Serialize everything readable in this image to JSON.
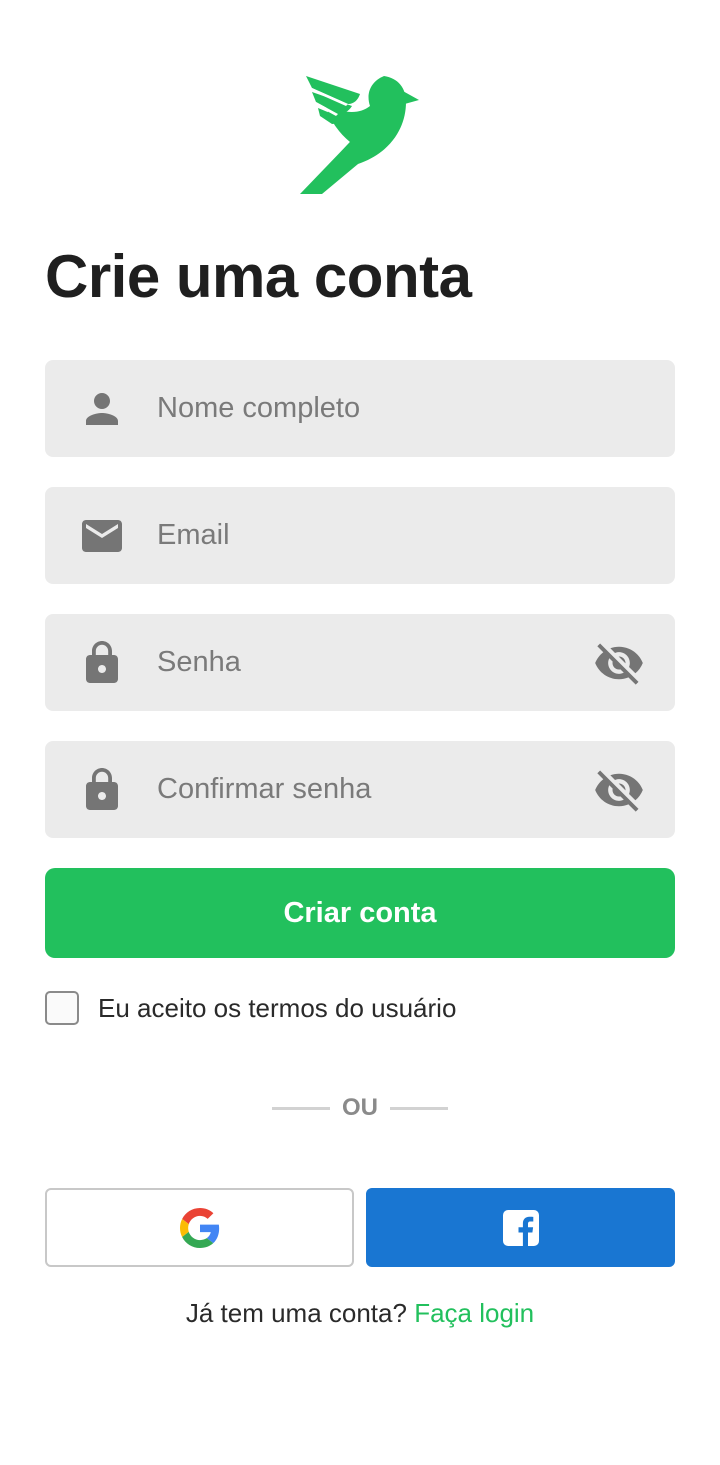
{
  "brand": {
    "accent_color": "#22c05d",
    "logo_icon": "bird-logo-icon"
  },
  "title": "Crie uma conta",
  "form": {
    "name": {
      "placeholder": "Nome completo",
      "value": "",
      "icon": "person-icon"
    },
    "email": {
      "placeholder": "Email",
      "value": "",
      "icon": "mail-icon"
    },
    "password": {
      "placeholder": "Senha",
      "value": "",
      "icon": "lock-icon",
      "toggle_icon": "eye-off-icon"
    },
    "confirm_password": {
      "placeholder": "Confirmar senha",
      "value": "",
      "icon": "lock-icon",
      "toggle_icon": "eye-off-icon"
    },
    "submit_label": "Criar conta",
    "terms_label": "Eu aceito os termos do usuário",
    "terms_checked": false
  },
  "divider_text": "OU",
  "social": {
    "google_icon": "google-icon",
    "facebook_icon": "facebook-icon",
    "facebook_color": "#1976d2"
  },
  "footer": {
    "prompt": "Já tem uma conta?",
    "link_label": "Faça login"
  }
}
